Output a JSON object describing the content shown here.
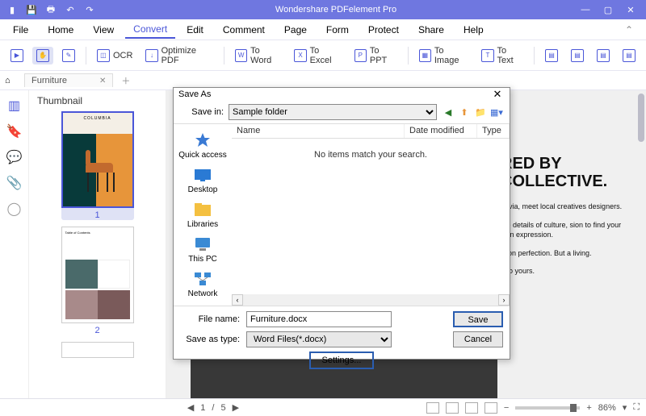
{
  "app": {
    "title": "Wondershare PDFelement Pro"
  },
  "menu": {
    "items": [
      "File",
      "Home",
      "View",
      "Convert",
      "Edit",
      "Comment",
      "Page",
      "Form",
      "Protect",
      "Share",
      "Help"
    ],
    "active": "Convert"
  },
  "toolbar": {
    "ocr": "OCR",
    "optimize": "Optimize PDF",
    "toWord": "To Word",
    "toExcel": "To Excel",
    "toPPT": "To PPT",
    "toImage": "To Image",
    "toText": "To Text"
  },
  "tab": {
    "name": "Furniture"
  },
  "sidepanel": {
    "title": "Thumbnail",
    "page1": "1",
    "page2": "2",
    "p1title": "COLUMBIA"
  },
  "document": {
    "heading": "RED BY COLLECTIVE.",
    "p1": "navia, meet local creatives designers.",
    "p2": "the details of culture, sion to find your own expression.",
    "p3": "ilt on perfection. But a living.",
    "p4": "e to yours."
  },
  "status": {
    "page": "1",
    "total": "5",
    "zoom": "86%"
  },
  "dialog": {
    "title": "Save As",
    "saveInLabel": "Save in:",
    "saveInValue": "Sample folder",
    "cols": {
      "name": "Name",
      "date": "Date modified",
      "type": "Type"
    },
    "empty": "No items match your search.",
    "places": {
      "quick": "Quick access",
      "desktop": "Desktop",
      "libraries": "Libraries",
      "thispc": "This PC",
      "network": "Network"
    },
    "fileNameLabel": "File name:",
    "fileNameValue": "Furniture.docx",
    "saveTypeLabel": "Save as type:",
    "saveTypeValue": "Word Files(*.docx)",
    "save": "Save",
    "cancel": "Cancel",
    "settings": "Settings..."
  }
}
